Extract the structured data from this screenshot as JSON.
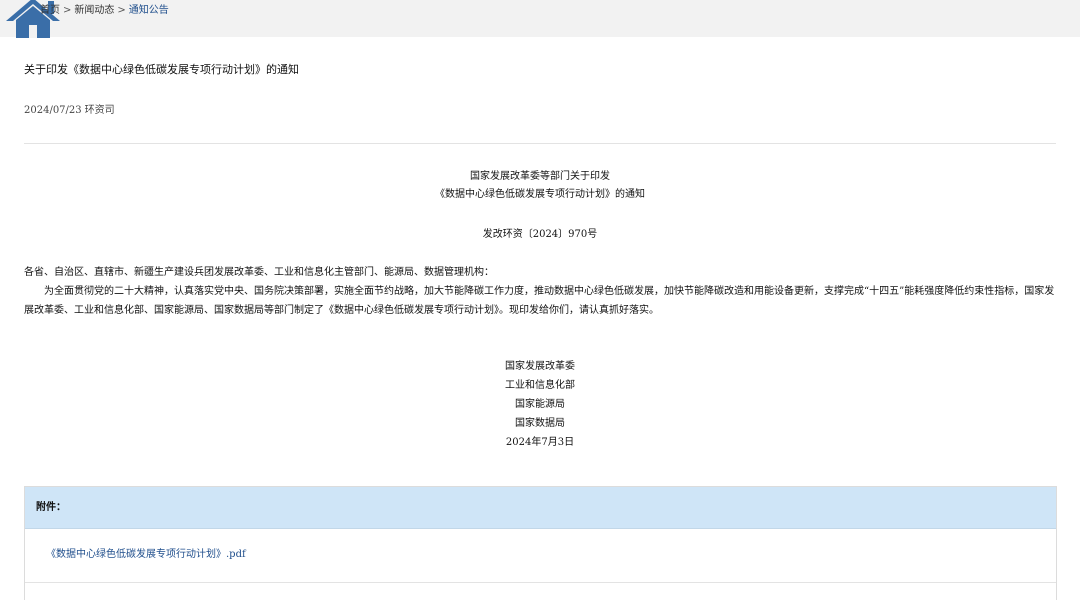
{
  "breadcrumb": {
    "home": "首页",
    "section": "新闻动态",
    "current": "通知公告",
    "separator": ">"
  },
  "article": {
    "title": "关于印发《数据中心绿色低碳发展专项行动计划》的通知",
    "date": "2024/07/23",
    "source": "环资司"
  },
  "document": {
    "heading_line1": "国家发展改革委等部门关于印发",
    "heading_line2": "《数据中心绿色低碳发展专项行动计划》的通知",
    "doc_number": "发改环资〔2024〕970号",
    "addressees": "各省、自治区、直辖市、新疆生产建设兵团发展改革委、工业和信息化主管部门、能源局、数据管理机构：",
    "paragraph": "为全面贯彻党的二十大精神，认真落实党中央、国务院决策部署，实施全面节约战略，加大节能降碳工作力度，推动数据中心绿色低碳发展，加快节能降碳改造和用能设备更新，支撑完成“十四五”能耗强度降低约束性指标，国家发展改革委、工业和信息化部、国家能源局、国家数据局等部门制定了《数据中心绿色低碳发展专项行动计划》。现印发给你们，请认真抓好落实。",
    "signatories": [
      "国家发展改革委",
      "工业和信息化部",
      "国家能源局",
      "国家数据局"
    ],
    "sign_date": "2024年7月3日"
  },
  "attachments": {
    "label": "附件：",
    "items": [
      {
        "name": "《数据中心绿色低碳发展专项行动计划》.pdf"
      }
    ]
  },
  "colors": {
    "link": "#1f4e8c",
    "attachment_header_bg": "#cfe5f7",
    "icon": "#3a6ea8"
  },
  "icons": {
    "home": "home-icon"
  }
}
